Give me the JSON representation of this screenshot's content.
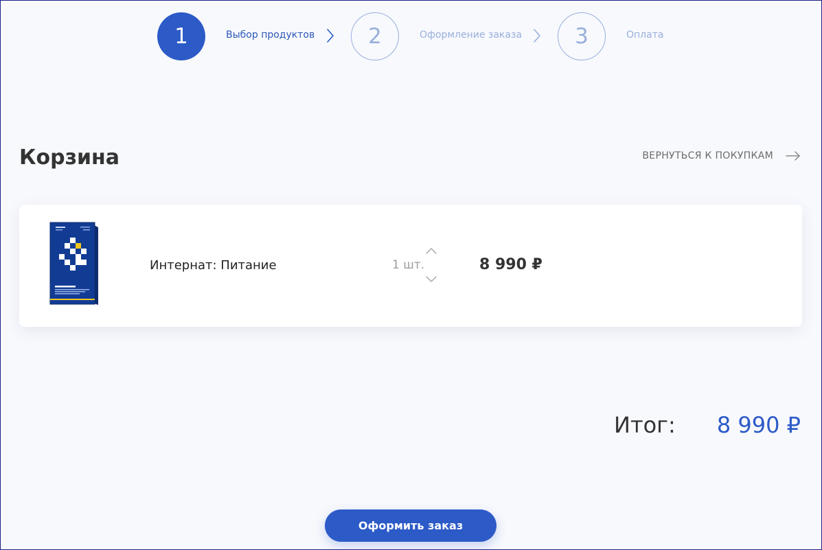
{
  "stepper": {
    "steps": [
      {
        "number": "1",
        "label": "Выбор продуктов",
        "state": "active"
      },
      {
        "number": "2",
        "label": "Оформление заказа",
        "state": "inactive"
      },
      {
        "number": "3",
        "label": "Оплата",
        "state": "inactive"
      }
    ],
    "separator_icon": "chevron-right-icon"
  },
  "header": {
    "title": "Корзина",
    "back_link_label": "ВЕРНУТЬСЯ К ПОКУПКАМ",
    "back_link_icon": "arrow-right-icon"
  },
  "cart": {
    "items": [
      {
        "name": "Интернат: Питание",
        "quantity": "1 шт.",
        "price": "8 990 ₽",
        "image_icon": "product-box-icon",
        "quantity_up_icon": "chevron-up-icon",
        "quantity_down_icon": "chevron-down-icon"
      }
    ]
  },
  "summary": {
    "total_label": "Итог:",
    "total_value": "8 990 ₽"
  },
  "actions": {
    "submit_label": "Оформить заказ"
  },
  "colors": {
    "accent": "#2c5ac7",
    "accent_light": "#98afdb",
    "text_dark": "#333333",
    "text_muted": "#9b9b9b",
    "page_background": "#f8f9fd",
    "card_background": "#ffffff"
  }
}
